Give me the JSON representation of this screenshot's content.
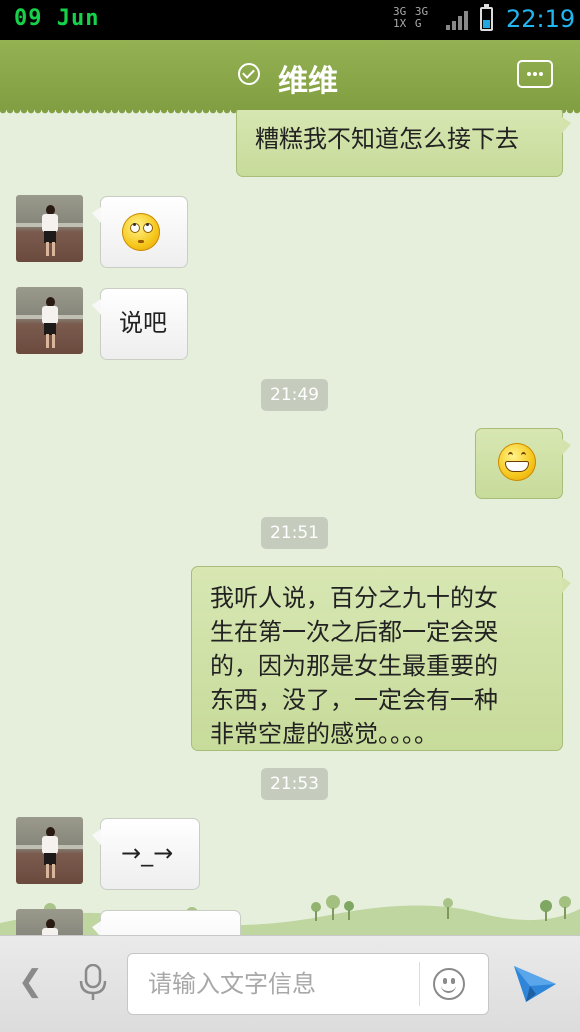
{
  "status_bar": {
    "date": "09 Jun",
    "network": "3G 3G 1X G",
    "time": "22:19"
  },
  "header": {
    "title": "维维"
  },
  "messages": [
    {
      "side": "out",
      "text": "糟糕我不知道怎么接下去"
    },
    {
      "side": "in",
      "emoji": "rolling-eyes-emoji"
    },
    {
      "side": "in",
      "text": "说吧"
    },
    {
      "timestamp": "21:49"
    },
    {
      "side": "out",
      "emoji": "grinning-emoji"
    },
    {
      "timestamp": "21:51"
    },
    {
      "side": "out",
      "text_lines": [
        "我听人说，百分之九十的女",
        "生在第一次之后都一定会哭",
        "的，因为那是女生最重要的",
        "东西，没了，一定会有一种",
        "非常空虚的感觉。。。。"
      ]
    },
    {
      "timestamp": "21:53"
    },
    {
      "side": "in",
      "text": "→_→"
    },
    {
      "side": "in",
      "text": ""
    }
  ],
  "input_bar": {
    "placeholder": "请输入文字信息",
    "value": ""
  },
  "colors": {
    "header": "#8aa84a",
    "chat_bg": "#e6efdc",
    "bubble_out": "#cfe0a6",
    "bubble_in": "#ffffff",
    "send_icon": "#2f86d8"
  }
}
